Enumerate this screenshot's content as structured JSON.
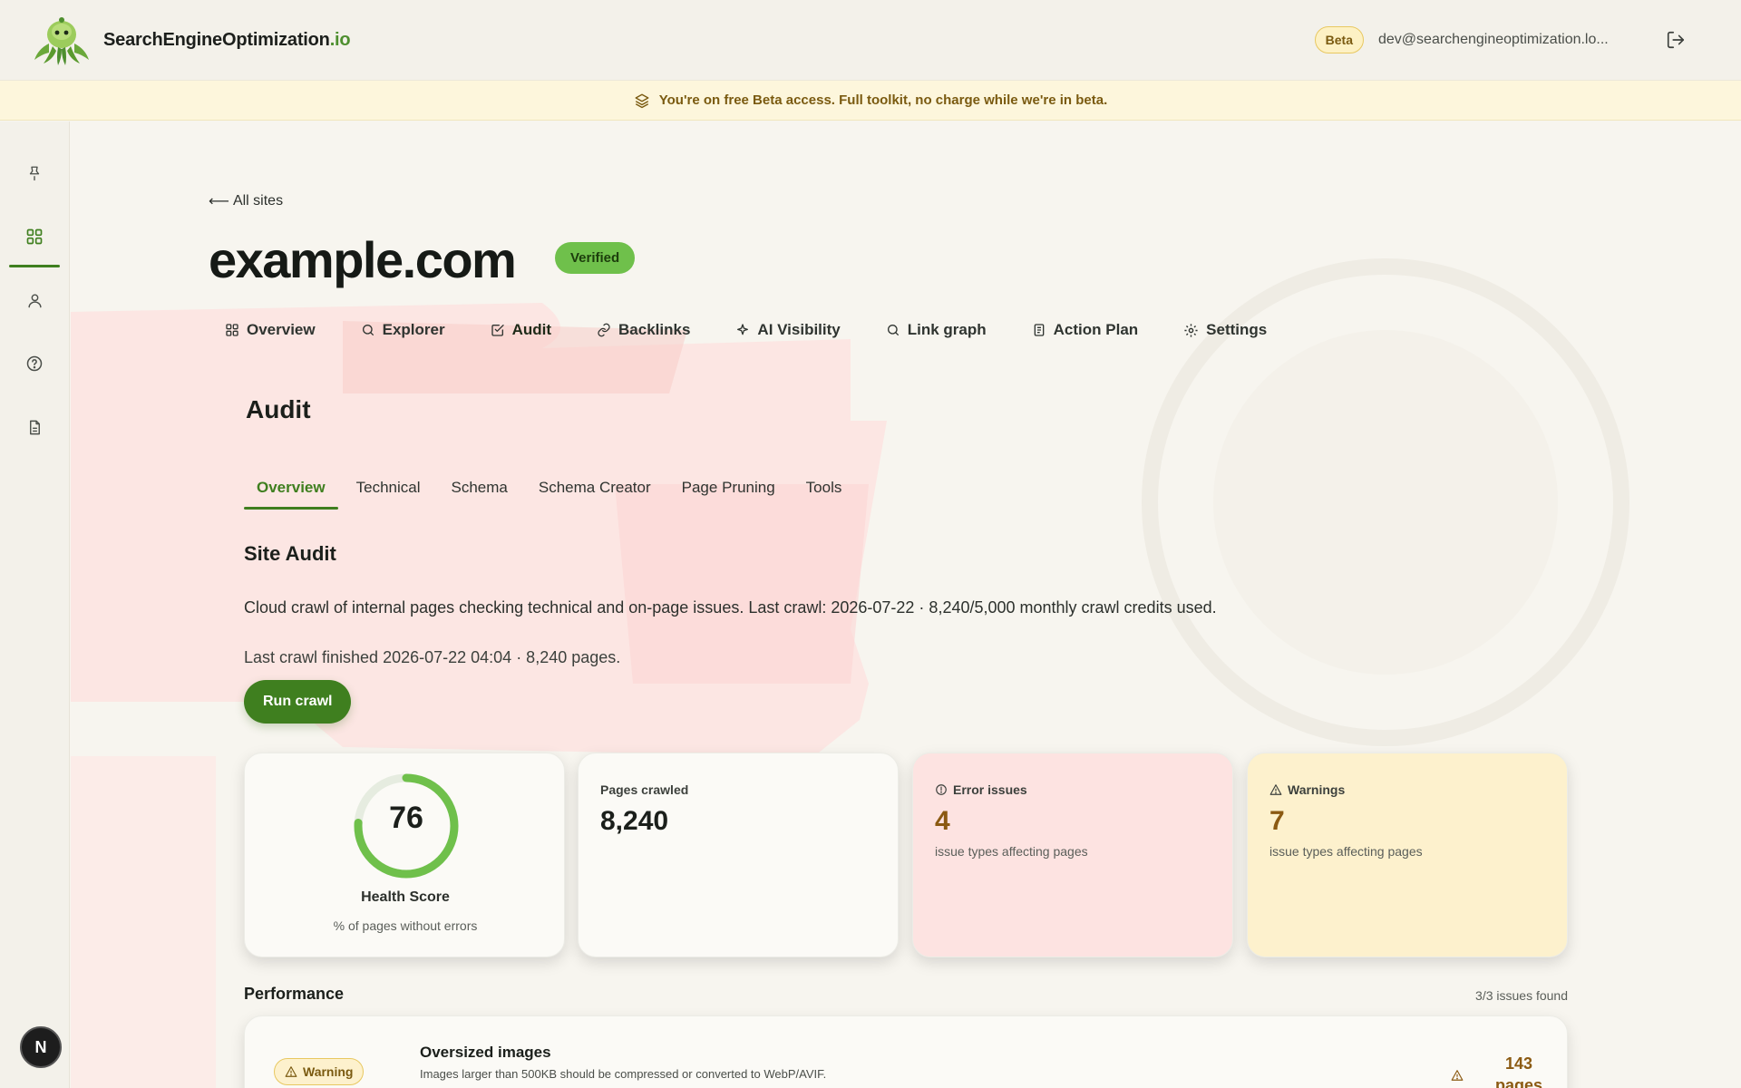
{
  "brand": {
    "name": "SearchEngineOptimization",
    "tld": ".io"
  },
  "header": {
    "beta_label": "Beta",
    "user_email": "dev@searchengineoptimization.lo..."
  },
  "banner": {
    "text": "You're on free Beta access. Full toolkit, no charge while we're in beta."
  },
  "sidebar": {
    "avatar_initial": "N"
  },
  "site": {
    "back_label": "All sites",
    "name": "example.com",
    "status": "Verified"
  },
  "tabs": [
    {
      "label": "Overview",
      "icon": "grid-icon"
    },
    {
      "label": "Explorer",
      "icon": "search-icon"
    },
    {
      "label": "Audit",
      "icon": "checkbox-icon"
    },
    {
      "label": "Backlinks",
      "icon": "link-icon"
    },
    {
      "label": "AI Visibility",
      "icon": "sparkle-icon"
    },
    {
      "label": "Link graph",
      "icon": "search-icon"
    },
    {
      "label": "Action Plan",
      "icon": "clipboard-icon"
    },
    {
      "label": "Settings",
      "icon": "gear-icon"
    }
  ],
  "audit": {
    "title": "Audit",
    "subtabs": [
      "Overview",
      "Technical",
      "Schema",
      "Schema Creator",
      "Page Pruning",
      "Tools"
    ],
    "section_title": "Site Audit",
    "description": "Cloud crawl of internal pages checking technical and on-page issues. Last crawl: 2026-07-22 · 8,240/5,000 monthly crawl credits used.",
    "last_crawl": "Last crawl finished 2026-07-22 04:04 · 8,240 pages.",
    "run_button": "Run crawl"
  },
  "stats": {
    "health": {
      "value": "76",
      "fraction": 0.76,
      "label": "Health Score",
      "sub": "% of pages without errors"
    },
    "pages": {
      "label": "Pages crawled",
      "value": "8,240"
    },
    "errors": {
      "label": "Error issues",
      "value": "4",
      "sub": "issue types affecting pages"
    },
    "warnings": {
      "label": "Warnings",
      "value": "7",
      "sub": "issue types affecting pages"
    }
  },
  "performance": {
    "title": "Performance",
    "count": "3/3 issues found",
    "issue": {
      "severity": "Warning",
      "title": "Oversized images",
      "description": "Images larger than 500KB should be compressed or converted to WebP/AVIF.",
      "count": "143",
      "unit": "pages"
    }
  },
  "colors": {
    "accent": "#3f7f1f",
    "verified": "#6fc04b",
    "error_bg": "#fde3e1",
    "warning_bg": "#fdf1cd",
    "banner_bg": "#fdf6dc"
  }
}
